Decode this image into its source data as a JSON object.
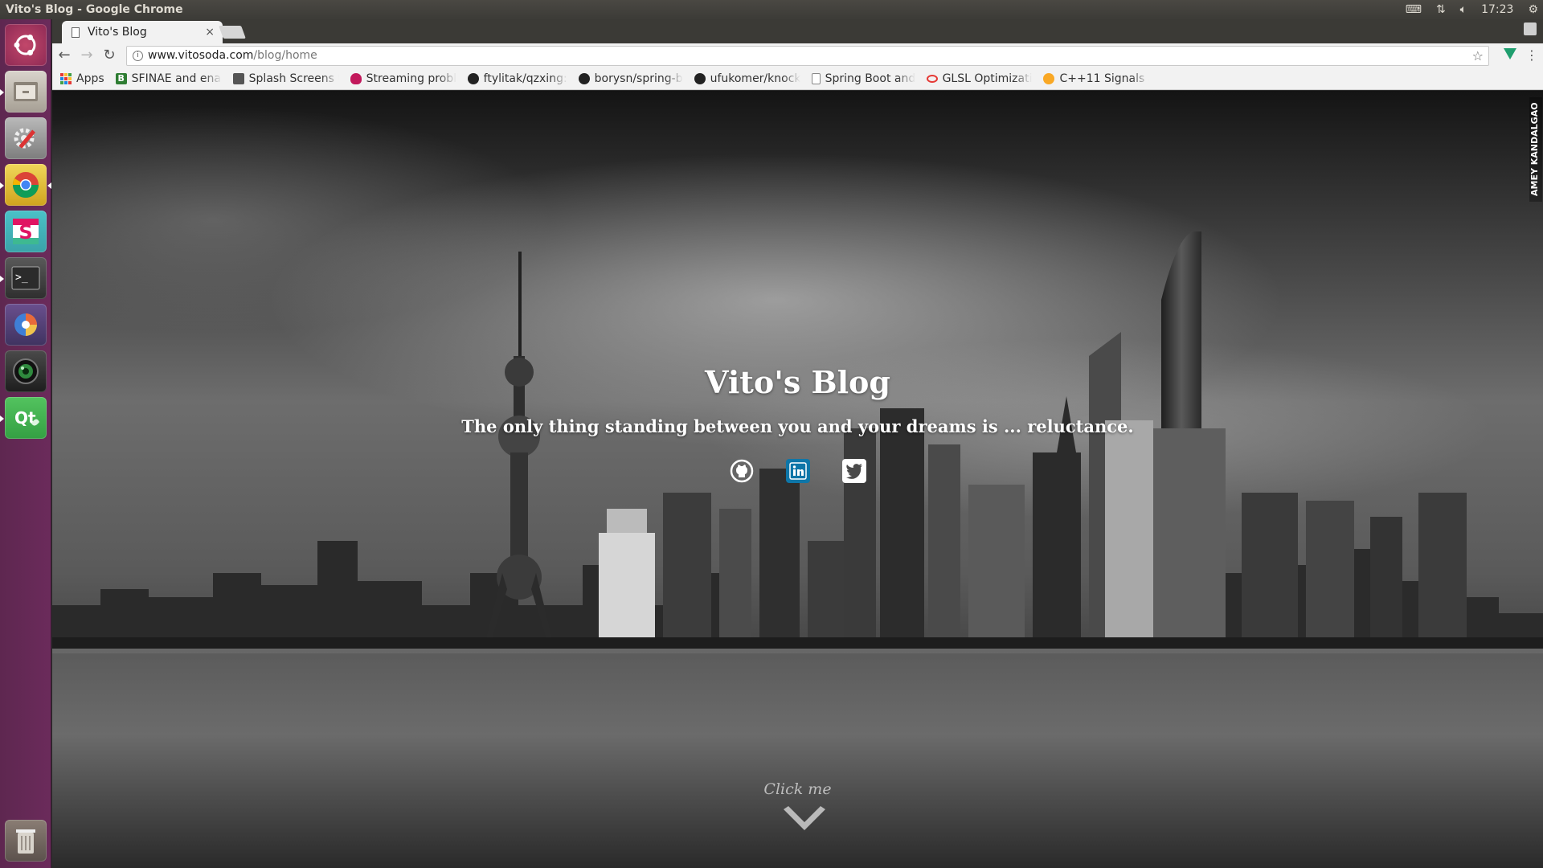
{
  "system": {
    "window_title": "Vito's Blog - Google Chrome",
    "clock": "17:23"
  },
  "launcher": {
    "items": [
      "ubuntu-dash",
      "files",
      "settings",
      "chrome",
      "slack",
      "terminal",
      "blender",
      "webcam",
      "qt-creator",
      "trash"
    ]
  },
  "browser": {
    "tab_title": "Vito's Blog",
    "tab_close": "×",
    "url_host": "www.vitosoda.com",
    "url_path": "/blog/home",
    "bookmarks": [
      {
        "label": "Apps",
        "icon": "apps-grid-icon"
      },
      {
        "label": "SFINAE and enab",
        "icon": "bookmark-b-icon"
      },
      {
        "label": "Splash Screens t",
        "icon": "image-icon"
      },
      {
        "label": "Streaming probl",
        "icon": "raspberry-icon"
      },
      {
        "label": "ftylitak/qzxing:",
        "icon": "github-icon"
      },
      {
        "label": "borysn/spring-b",
        "icon": "github-icon"
      },
      {
        "label": "ufukomer/knock",
        "icon": "github-icon"
      },
      {
        "label": "Spring Boot and",
        "icon": "page-icon"
      },
      {
        "label": "GLSL Optimizati",
        "icon": "glsl-icon"
      },
      {
        "label": "C++11 Signals ar",
        "icon": "smiley-icon"
      }
    ]
  },
  "page": {
    "title": "Vito's Blog",
    "subtitle": "The only thing standing between you and your dreams is ... reluctance.",
    "social": [
      "github-icon",
      "linkedin-icon",
      "twitter-icon"
    ],
    "cta": "Click me",
    "watermark": "AMEY KANDALGAO"
  },
  "colors": {
    "launcher": "#5e2750",
    "linkedin": "#0e76a8",
    "extension": "#1f9e6e"
  }
}
